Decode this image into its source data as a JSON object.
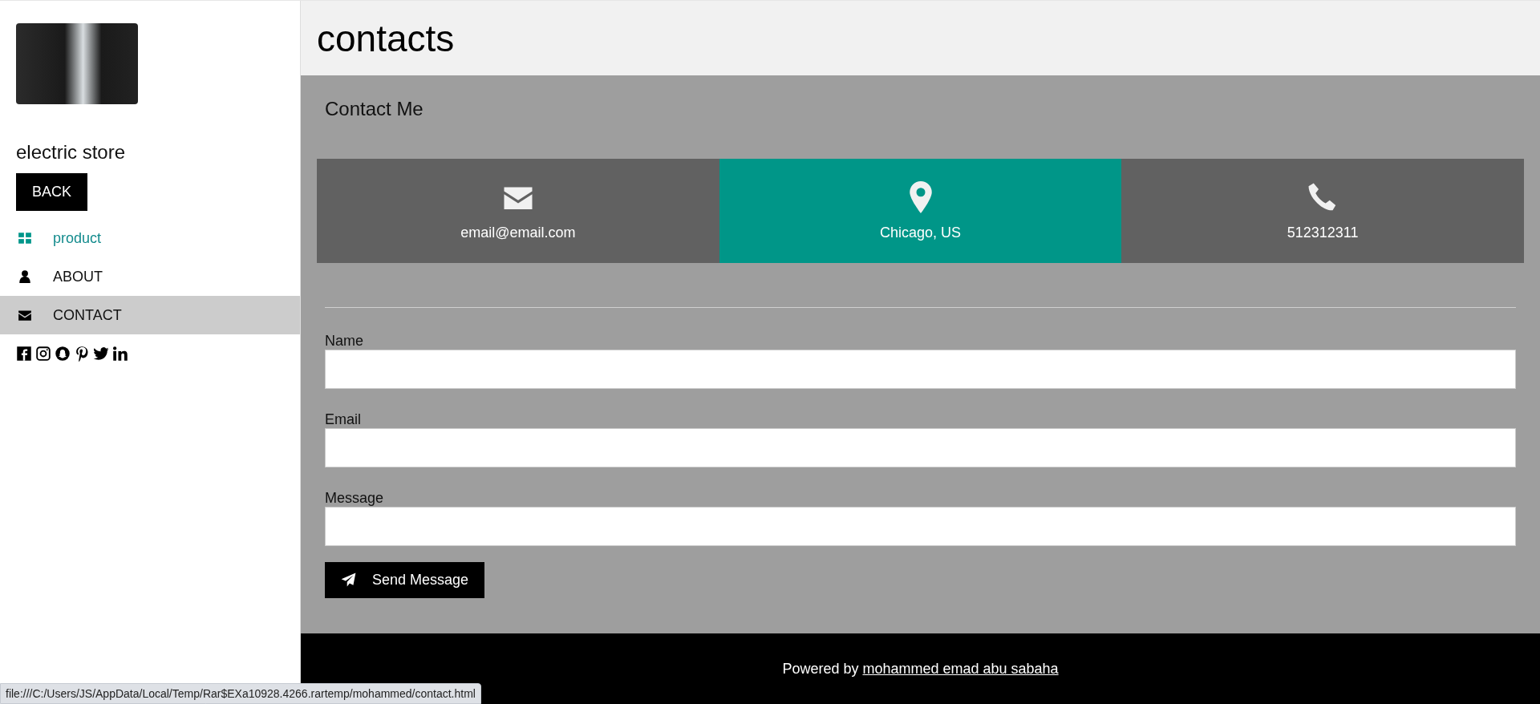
{
  "sidebar": {
    "store_name": "electric store",
    "back_button": "BACK",
    "nav_items": [
      {
        "label": "product",
        "selected": false,
        "highlighted": true
      },
      {
        "label": "ABOUT",
        "selected": false,
        "highlighted": false
      },
      {
        "label": "CONTACT",
        "selected": true,
        "highlighted": false
      }
    ]
  },
  "header": {
    "title": "contacts"
  },
  "contact_section": {
    "heading": "Contact Me",
    "cards": [
      {
        "text": "email@email.com",
        "color": "#616161"
      },
      {
        "text": "Chicago, US",
        "color": "#009688"
      },
      {
        "text": "512312311",
        "color": "#616161"
      }
    ],
    "form": {
      "fields": [
        {
          "label": "Name",
          "kind": "input"
        },
        {
          "label": "Email",
          "kind": "input"
        },
        {
          "label": "Message",
          "kind": "input"
        }
      ],
      "submit": "Send Message"
    }
  },
  "footer": {
    "text": "Powered by",
    "link": "mohammed emad abu sabaha"
  },
  "status_bar": {
    "url": "file:///C:/Users/JS/AppData/Local/Temp/Rar$EXa10928.4266.rartemp/mohammed/contact.html"
  }
}
